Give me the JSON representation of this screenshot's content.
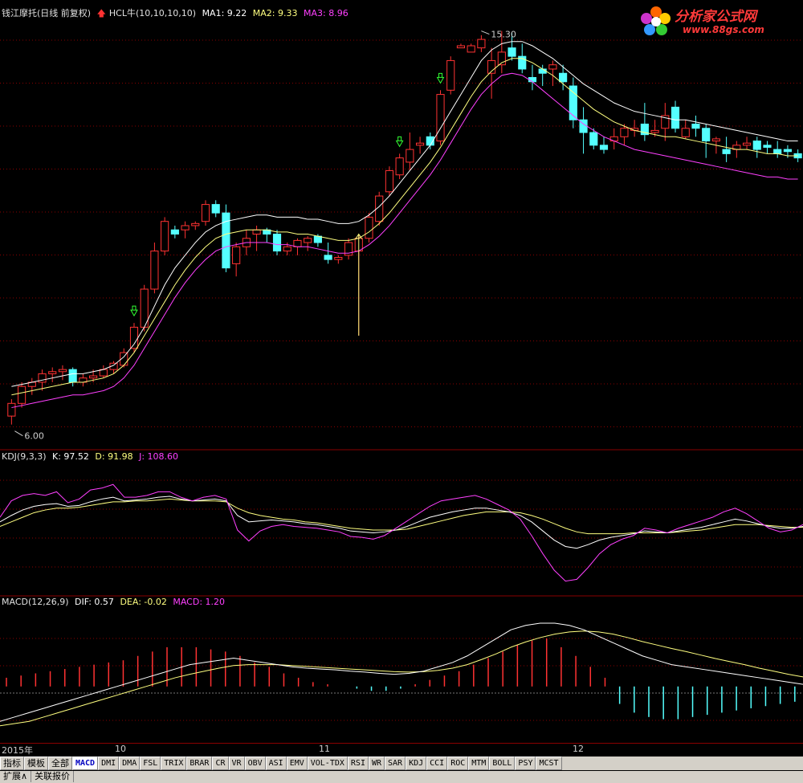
{
  "header": {
    "stock": "钱江摩托(日线 前复权)",
    "indicator": "HCL牛(10,10,10,10)",
    "ma1": "MA1: 9.22",
    "ma2": "MA2: 9.33",
    "ma3": "MA3: 8.96"
  },
  "price_labels": {
    "high": "15.30",
    "low": "6.00"
  },
  "kdj": {
    "title": "KDJ(9,3,3)",
    "k": "K: 97.52",
    "d": "D: 91.98",
    "j": "J: 108.60"
  },
  "macd": {
    "title": "MACD(12,26,9)",
    "dif": "DIF: 0.57",
    "dea": "DEA: -0.02",
    "macd": "MACD: 1.20"
  },
  "dates": {
    "d1": "2015年",
    "d2": "10",
    "d3": "11",
    "d4": "12"
  },
  "watermark": {
    "title": "分析家公式网",
    "url": "www.88gs.com"
  },
  "tabs": [
    "指标",
    "模板",
    "全部",
    "MACD",
    "DMI",
    "DMA",
    "FSL",
    "TRIX",
    "BRAR",
    "CR",
    "VR",
    "OBV",
    "ASI",
    "EMV",
    "VOL-TDX",
    "RSI",
    "WR",
    "SAR",
    "KDJ",
    "CCI",
    "ROC",
    "MTM",
    "BOLL",
    "PSY",
    "MCST"
  ],
  "active_tab": "MACD",
  "bottom_buttons": [
    "扩展∧",
    "关联报价"
  ],
  "colors": {
    "up": "#ff3232",
    "down": "#54ffff",
    "ma1": "#ffffff",
    "ma2": "#ffff80",
    "ma3": "#ff40ff",
    "grid": "#8a0000"
  },
  "chart_data": {
    "type": "candlestick",
    "candles": [
      [
        6.2,
        6.6,
        6.0,
        6.5
      ],
      [
        6.5,
        7.0,
        6.4,
        6.9
      ],
      [
        6.9,
        7.1,
        6.7,
        7.0
      ],
      [
        7.0,
        7.3,
        6.8,
        7.2
      ],
      [
        7.2,
        7.35,
        7.0,
        7.25
      ],
      [
        7.25,
        7.4,
        7.05,
        7.3
      ],
      [
        7.3,
        7.35,
        6.9,
        7.0
      ],
      [
        7.0,
        7.2,
        6.9,
        7.1
      ],
      [
        7.1,
        7.3,
        7.0,
        7.15
      ],
      [
        7.15,
        7.4,
        7.1,
        7.3
      ],
      [
        7.3,
        7.5,
        7.2,
        7.45
      ],
      [
        7.4,
        7.8,
        7.35,
        7.7
      ],
      [
        7.8,
        8.4,
        7.7,
        8.3
      ],
      [
        8.3,
        9.3,
        8.2,
        9.2
      ],
      [
        9.2,
        10.3,
        9.1,
        10.1
      ],
      [
        10.1,
        10.9,
        10.0,
        10.8
      ],
      [
        10.6,
        10.7,
        10.4,
        10.5
      ],
      [
        10.6,
        10.8,
        10.4,
        10.7
      ],
      [
        10.7,
        10.8,
        10.6,
        10.75
      ],
      [
        10.8,
        11.3,
        10.7,
        11.2
      ],
      [
        11.2,
        11.3,
        10.9,
        11.0
      ],
      [
        11.0,
        11.2,
        9.6,
        9.7
      ],
      [
        9.8,
        10.3,
        9.5,
        10.2
      ],
      [
        10.2,
        10.6,
        10.0,
        10.4
      ],
      [
        10.5,
        10.7,
        10.1,
        10.6
      ],
      [
        10.6,
        10.65,
        10.3,
        10.5
      ],
      [
        10.5,
        10.6,
        10.0,
        10.1
      ],
      [
        10.1,
        10.3,
        10.0,
        10.2
      ],
      [
        10.2,
        10.4,
        10.0,
        10.35
      ],
      [
        10.3,
        10.45,
        10.1,
        10.4
      ],
      [
        10.45,
        10.5,
        10.2,
        10.3
      ],
      [
        10.0,
        10.3,
        9.8,
        9.9
      ],
      [
        9.9,
        10.0,
        9.8,
        9.95
      ],
      [
        10.0,
        10.4,
        9.9,
        10.3
      ],
      [
        10.1,
        10.5,
        8.1,
        10.4
      ],
      [
        10.4,
        11.0,
        10.3,
        10.9
      ],
      [
        10.8,
        11.5,
        10.7,
        11.4
      ],
      [
        11.5,
        12.1,
        11.4,
        12.0
      ],
      [
        11.9,
        12.4,
        11.8,
        12.3
      ],
      [
        12.2,
        12.9,
        12.0,
        12.5
      ],
      [
        12.6,
        12.8,
        12.4,
        12.65
      ],
      [
        12.8,
        12.9,
        12.5,
        12.6
      ],
      [
        12.7,
        13.9,
        12.6,
        13.8
      ],
      [
        13.9,
        14.7,
        13.8,
        14.6
      ],
      [
        14.9,
        15.0,
        14.9,
        14.95
      ],
      [
        14.8,
        15.0,
        14.8,
        14.95
      ],
      [
        14.9,
        15.2,
        14.8,
        15.1
      ],
      [
        14.3,
        14.9,
        13.7,
        14.6
      ],
      [
        14.5,
        15.3,
        14.3,
        14.8
      ],
      [
        14.9,
        15.25,
        14.6,
        14.7
      ],
      [
        14.7,
        15.0,
        14.3,
        14.4
      ],
      [
        14.2,
        14.5,
        13.9,
        14.1
      ],
      [
        14.4,
        14.5,
        14.0,
        14.3
      ],
      [
        14.4,
        14.6,
        14.0,
        14.5
      ],
      [
        14.3,
        14.5,
        13.9,
        14.1
      ],
      [
        14.0,
        14.2,
        13.0,
        13.2
      ],
      [
        13.2,
        13.5,
        12.4,
        12.9
      ],
      [
        12.9,
        13.0,
        12.5,
        12.6
      ],
      [
        12.6,
        12.8,
        12.4,
        12.5
      ],
      [
        12.7,
        13.0,
        12.5,
        12.8
      ],
      [
        12.8,
        13.1,
        12.6,
        13.0
      ],
      [
        12.95,
        13.2,
        12.8,
        13.0
      ],
      [
        13.1,
        13.6,
        12.7,
        12.85
      ],
      [
        12.9,
        13.2,
        12.8,
        12.95
      ],
      [
        13.0,
        13.6,
        12.7,
        13.3
      ],
      [
        13.5,
        13.65,
        12.9,
        13.0
      ],
      [
        12.8,
        13.2,
        12.75,
        13.0
      ],
      [
        13.1,
        13.3,
        12.8,
        13.0
      ],
      [
        13.0,
        13.1,
        12.3,
        12.7
      ],
      [
        12.7,
        12.8,
        12.4,
        12.75
      ],
      [
        12.5,
        12.8,
        12.2,
        12.4
      ],
      [
        12.5,
        12.7,
        12.3,
        12.6
      ],
      [
        12.6,
        12.8,
        12.5,
        12.65
      ],
      [
        12.7,
        12.8,
        12.3,
        12.5
      ],
      [
        12.6,
        12.7,
        12.4,
        12.55
      ],
      [
        12.5,
        12.7,
        12.3,
        12.4
      ],
      [
        12.5,
        12.6,
        12.3,
        12.45
      ],
      [
        12.4,
        12.5,
        12.2,
        12.3
      ]
    ],
    "ma1": [
      6.9,
      6.95,
      7.0,
      7.05,
      7.1,
      7.15,
      7.2,
      7.2,
      7.25,
      7.3,
      7.4,
      7.6,
      7.9,
      8.3,
      8.8,
      9.3,
      9.7,
      10.0,
      10.3,
      10.55,
      10.7,
      10.8,
      10.85,
      10.9,
      10.95,
      10.95,
      10.9,
      10.9,
      10.9,
      10.85,
      10.85,
      10.8,
      10.75,
      10.75,
      10.8,
      10.95,
      11.15,
      11.4,
      11.7,
      12.0,
      12.3,
      12.6,
      13.0,
      13.4,
      13.8,
      14.2,
      14.6,
      14.85,
      15.0,
      15.05,
      15.05,
      14.95,
      14.8,
      14.65,
      14.45,
      14.25,
      14.05,
      13.9,
      13.75,
      13.6,
      13.5,
      13.4,
      13.35,
      13.3,
      13.25,
      13.2,
      13.2,
      13.15,
      13.1,
      13.05,
      13.0,
      12.95,
      12.9,
      12.85,
      12.8,
      12.75,
      12.7,
      12.7
    ],
    "ma2": [
      6.7,
      6.75,
      6.8,
      6.85,
      6.9,
      6.95,
      7.0,
      7.0,
      7.05,
      7.1,
      7.2,
      7.4,
      7.7,
      8.1,
      8.5,
      8.9,
      9.3,
      9.65,
      9.95,
      10.2,
      10.4,
      10.5,
      10.55,
      10.6,
      10.6,
      10.6,
      10.55,
      10.55,
      10.5,
      10.5,
      10.45,
      10.4,
      10.35,
      10.35,
      10.4,
      10.55,
      10.75,
      11.0,
      11.3,
      11.6,
      11.9,
      12.2,
      12.55,
      12.95,
      13.35,
      13.75,
      14.1,
      14.35,
      14.55,
      14.65,
      14.65,
      14.55,
      14.4,
      14.25,
      14.05,
      13.85,
      13.65,
      13.45,
      13.3,
      13.15,
      13.05,
      12.95,
      12.9,
      12.85,
      12.8,
      12.8,
      12.75,
      12.7,
      12.65,
      12.6,
      12.55,
      12.5,
      12.5,
      12.45,
      12.4,
      12.4,
      12.35,
      12.35
    ],
    "ma3": [
      6.4,
      6.45,
      6.5,
      6.55,
      6.6,
      6.65,
      6.7,
      6.7,
      6.75,
      6.8,
      6.9,
      7.1,
      7.4,
      7.8,
      8.2,
      8.6,
      9.0,
      9.35,
      9.65,
      9.9,
      10.1,
      10.2,
      10.25,
      10.3,
      10.3,
      10.3,
      10.25,
      10.25,
      10.2,
      10.2,
      10.15,
      10.1,
      10.05,
      10.05,
      10.1,
      10.25,
      10.45,
      10.7,
      11.0,
      11.3,
      11.6,
      11.9,
      12.25,
      12.65,
      13.05,
      13.45,
      13.8,
      14.05,
      14.25,
      14.3,
      14.25,
      14.1,
      13.9,
      13.7,
      13.5,
      13.3,
      13.1,
      12.95,
      12.8,
      12.7,
      12.6,
      12.5,
      12.45,
      12.4,
      12.35,
      12.3,
      12.25,
      12.2,
      12.15,
      12.1,
      12.05,
      12.0,
      11.95,
      11.9,
      11.85,
      11.85,
      11.8,
      11.8
    ],
    "arrows": [
      {
        "i": 12,
        "type": "down"
      },
      {
        "i": 34,
        "type": "up"
      },
      {
        "i": 38,
        "type": "down"
      },
      {
        "i": 42,
        "type": "down"
      }
    ],
    "price_range": [
      5.5,
      15.5
    ],
    "kdj_k": [
      55,
      62,
      68,
      72,
      74,
      75,
      72,
      73,
      77,
      80,
      82,
      78,
      79,
      80,
      82,
      83,
      80,
      78,
      79,
      80,
      78,
      62,
      55,
      56,
      57,
      56,
      55,
      53,
      52,
      50,
      48,
      45,
      44,
      43,
      44,
      46,
      50,
      55,
      60,
      63,
      66,
      68,
      70,
      70,
      68,
      66,
      62,
      55,
      45,
      35,
      28,
      26,
      30,
      35,
      38,
      40,
      42,
      45,
      44,
      43,
      45,
      47,
      49,
      52,
      55,
      58,
      56,
      53,
      50,
      48,
      48,
      50
    ],
    "kdj_d": [
      50,
      55,
      60,
      65,
      68,
      70,
      70,
      71,
      73,
      75,
      77,
      77,
      78,
      78,
      79,
      80,
      79,
      78,
      78,
      78,
      77,
      70,
      65,
      62,
      60,
      58,
      57,
      55,
      54,
      52,
      50,
      48,
      47,
      46,
      46,
      46,
      47,
      50,
      53,
      56,
      59,
      62,
      64,
      66,
      66,
      66,
      65,
      62,
      58,
      53,
      48,
      44,
      42,
      42,
      42,
      42,
      43,
      43,
      43,
      43,
      44,
      45,
      46,
      48,
      50,
      52,
      52,
      52,
      51,
      50,
      49,
      49
    ],
    "kdj_j": [
      60,
      78,
      84,
      86,
      84,
      88,
      76,
      80,
      90,
      92,
      96,
      82,
      82,
      84,
      88,
      88,
      82,
      78,
      82,
      84,
      80,
      46,
      34,
      45,
      50,
      52,
      50,
      49,
      48,
      46,
      44,
      39,
      38,
      36,
      40,
      48,
      56,
      64,
      72,
      78,
      80,
      82,
      84,
      80,
      74,
      68,
      58,
      40,
      20,
      2,
      -10,
      -8,
      5,
      20,
      30,
      36,
      40,
      48,
      46,
      43,
      48,
      52,
      56,
      60,
      66,
      70,
      64,
      56,
      48,
      44,
      46,
      52
    ],
    "kdj_range": [
      -20,
      120
    ],
    "macd_dif": [
      -0.8,
      -0.7,
      -0.6,
      -0.5,
      -0.4,
      -0.3,
      -0.2,
      -0.1,
      0.0,
      0.1,
      0.2,
      0.3,
      0.4,
      0.5,
      0.55,
      0.6,
      0.65,
      0.6,
      0.55,
      0.5,
      0.45,
      0.42,
      0.4,
      0.38,
      0.35,
      0.33,
      0.3,
      0.28,
      0.3,
      0.35,
      0.45,
      0.55,
      0.7,
      0.9,
      1.1,
      1.3,
      1.4,
      1.45,
      1.45,
      1.4,
      1.3,
      1.15,
      1.0,
      0.85,
      0.7,
      0.6,
      0.5,
      0.45,
      0.4,
      0.35,
      0.3,
      0.25,
      0.2,
      0.15,
      0.1,
      0.05
    ],
    "macd_dea": [
      -0.9,
      -0.85,
      -0.8,
      -0.7,
      -0.6,
      -0.5,
      -0.4,
      -0.3,
      -0.2,
      -0.1,
      0.0,
      0.1,
      0.2,
      0.28,
      0.35,
      0.42,
      0.48,
      0.5,
      0.5,
      0.5,
      0.48,
      0.46,
      0.44,
      0.42,
      0.4,
      0.38,
      0.36,
      0.34,
      0.33,
      0.34,
      0.37,
      0.42,
      0.5,
      0.62,
      0.75,
      0.9,
      1.02,
      1.12,
      1.2,
      1.25,
      1.27,
      1.25,
      1.2,
      1.12,
      1.03,
      0.95,
      0.87,
      0.8,
      0.72,
      0.64,
      0.57,
      0.5,
      0.42,
      0.35,
      0.28,
      0.22
    ],
    "macd_bar": [
      0.2,
      0.25,
      0.3,
      0.35,
      0.4,
      0.45,
      0.5,
      0.55,
      0.6,
      0.7,
      0.8,
      0.9,
      0.9,
      0.9,
      0.85,
      0.8,
      0.7,
      0.55,
      0.45,
      0.3,
      0.2,
      0.1,
      0.05,
      0.0,
      -0.05,
      -0.1,
      -0.1,
      -0.05,
      0.05,
      0.15,
      0.25,
      0.35,
      0.5,
      0.65,
      0.8,
      0.95,
      1.05,
      1.1,
      0.9,
      0.7,
      0.45,
      0.2,
      -0.4,
      -0.6,
      -0.7,
      -0.75,
      -0.75,
      -0.7,
      -0.65,
      -0.6,
      -0.55,
      -0.5,
      -0.45,
      -0.4,
      -0.35,
      -0.3
    ],
    "macd_range": [
      -1.2,
      1.8
    ]
  }
}
